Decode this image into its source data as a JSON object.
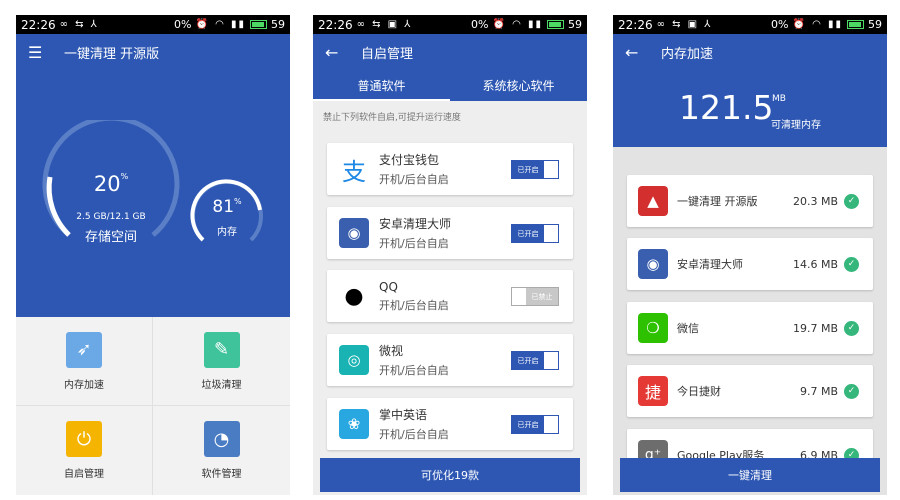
{
  "colors": {
    "primary": "#2d57b3",
    "status_bar": "#000000",
    "check": "#35b67b"
  },
  "screen1": {
    "status": {
      "time": "22:26",
      "battery_pct": "0%",
      "battery_level": "59"
    },
    "app_title": "一键清理 开源版",
    "storage": {
      "percent": "20",
      "unit": "%",
      "usage": "2.5 GB/12.1 GB",
      "label": "存储空间"
    },
    "memory": {
      "percent": "81",
      "unit": "%",
      "label": "内存"
    },
    "tiles": [
      {
        "label": "内存加速",
        "icon": "rocket-icon",
        "color": "#6aa8e6"
      },
      {
        "label": "垃圾清理",
        "icon": "broom-icon",
        "color": "#3ec39a"
      },
      {
        "label": "自启管理",
        "icon": "power-icon",
        "color": "#f5b400"
      },
      {
        "label": "软件管理",
        "icon": "pie-chart-icon",
        "color": "#4a7cc4"
      }
    ]
  },
  "screen2": {
    "status": {
      "time": "22:26",
      "battery_pct": "0%",
      "battery_level": "59"
    },
    "title": "自启管理",
    "tabs": [
      "普通软件",
      "系统核心软件"
    ],
    "hint": "禁止下列软件自启,可提升运行速度",
    "apps": [
      {
        "name": "支付宝钱包",
        "desc": "开机/后台自启",
        "toggle": "已开启",
        "icon": "alipay-icon",
        "color": "#ffffff"
      },
      {
        "name": "安卓清理大师",
        "desc": "开机/后台自启",
        "toggle": "已开启",
        "icon": "broom-icon",
        "color": "#3a5fae"
      },
      {
        "name": "QQ",
        "desc": "开机/后台自启",
        "toggle": "已禁止",
        "icon": "penguin-icon",
        "color": "#ffffff"
      },
      {
        "name": "微视",
        "desc": "开机/后台自启",
        "toggle": "已开启",
        "icon": "camera-icon",
        "color": "#1ab3b3"
      },
      {
        "name": "掌中英语",
        "desc": "开机/后台自启",
        "toggle": "已开启",
        "icon": "shell-icon",
        "color": "#29a7e0"
      }
    ],
    "bottom_button": "可优化19款"
  },
  "screen3": {
    "status": {
      "time": "22:26",
      "battery_pct": "0%",
      "battery_level": "59"
    },
    "title": "内存加速",
    "total": "121.5",
    "unit": "MB",
    "caption": "可清理内存",
    "apps": [
      {
        "name": "一键清理 开源版",
        "size": "20.3 MB",
        "icon": "cleaner-app-icon",
        "color": "#d32f2f"
      },
      {
        "name": "安卓清理大师",
        "size": "14.6 MB",
        "icon": "broom-icon",
        "color": "#3a5fae"
      },
      {
        "name": "微信",
        "size": "19.7 MB",
        "icon": "wechat-icon",
        "color": "#2dc100"
      },
      {
        "name": "今日捷财",
        "size": "9.7 MB",
        "icon": "finance-icon",
        "color": "#e53935"
      },
      {
        "name": "Google Play服务",
        "size": "6.9 MB",
        "icon": "google-icon",
        "color": "#6d6d6d"
      }
    ],
    "bottom_button": "一键清理"
  }
}
